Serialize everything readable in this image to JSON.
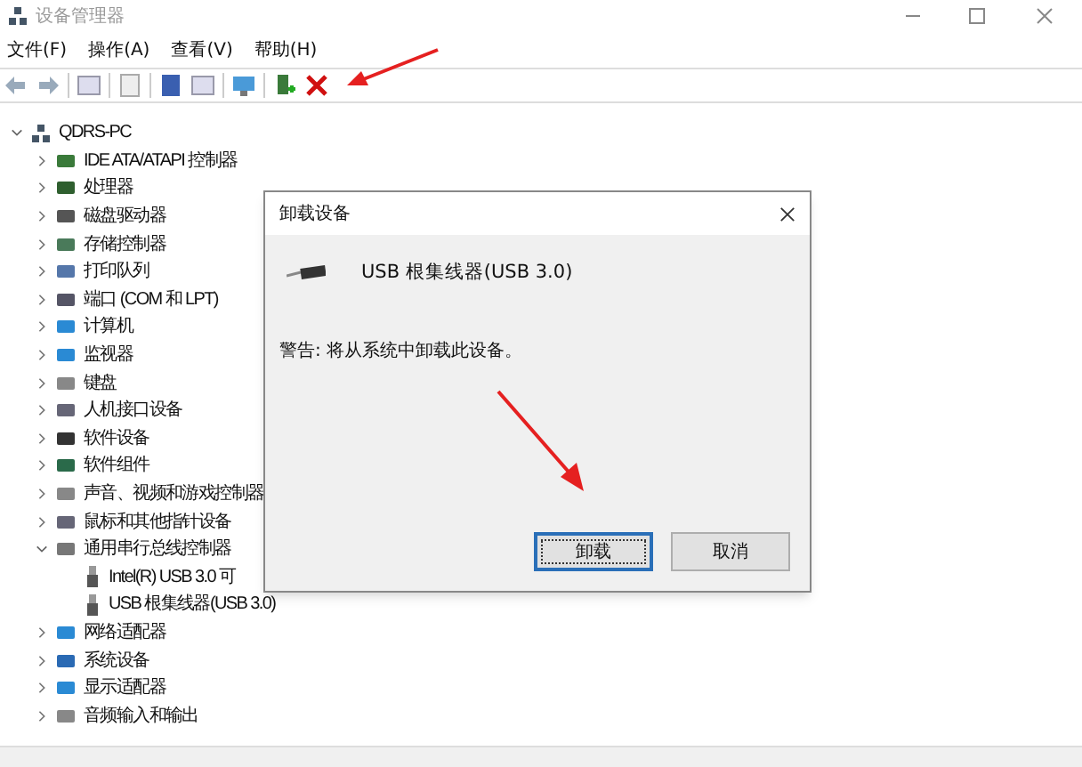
{
  "window": {
    "title": "设备管理器"
  },
  "menu": [
    "文件(F)",
    "操作(A)",
    "查看(V)",
    "帮助(H)"
  ],
  "tree": {
    "label": "QDRS-PC",
    "expanded": true,
    "children": [
      {
        "label": "IDE ATA/ATAPI 控制器",
        "expanded": false
      },
      {
        "label": "处理器",
        "expanded": false
      },
      {
        "label": "磁盘驱动器",
        "expanded": false
      },
      {
        "label": "存储控制器",
        "expanded": false
      },
      {
        "label": "打印队列",
        "expanded": false
      },
      {
        "label": "端口 (COM 和 LPT)",
        "expanded": false
      },
      {
        "label": "计算机",
        "expanded": false
      },
      {
        "label": "监视器",
        "expanded": false
      },
      {
        "label": "键盘",
        "expanded": false
      },
      {
        "label": "人机接口设备",
        "expanded": false
      },
      {
        "label": "软件设备",
        "expanded": false
      },
      {
        "label": "软件组件",
        "expanded": false
      },
      {
        "label": "声音、视频和游戏控制器",
        "expanded": false
      },
      {
        "label": "鼠标和其他指针设备",
        "expanded": false
      },
      {
        "label": "通用串行总线控制器",
        "expanded": true,
        "children": [
          {
            "label": "Intel(R) USB 3.0 可"
          },
          {
            "label": "USB 根集线器(USB 3.0)"
          }
        ]
      },
      {
        "label": "网络适配器",
        "expanded": false
      },
      {
        "label": "系统设备",
        "expanded": false
      },
      {
        "label": "显示适配器",
        "expanded": false
      },
      {
        "label": "音频输入和输出",
        "expanded": false
      }
    ]
  },
  "dialog": {
    "title": "卸载设备",
    "device": "USB 根集线器(USB 3.0)",
    "warning": "警告: 将从系统中卸载此设备。",
    "buttons": [
      {
        "label": "卸载",
        "selected": true
      },
      {
        "label": "取消",
        "selected": false
      }
    ]
  }
}
